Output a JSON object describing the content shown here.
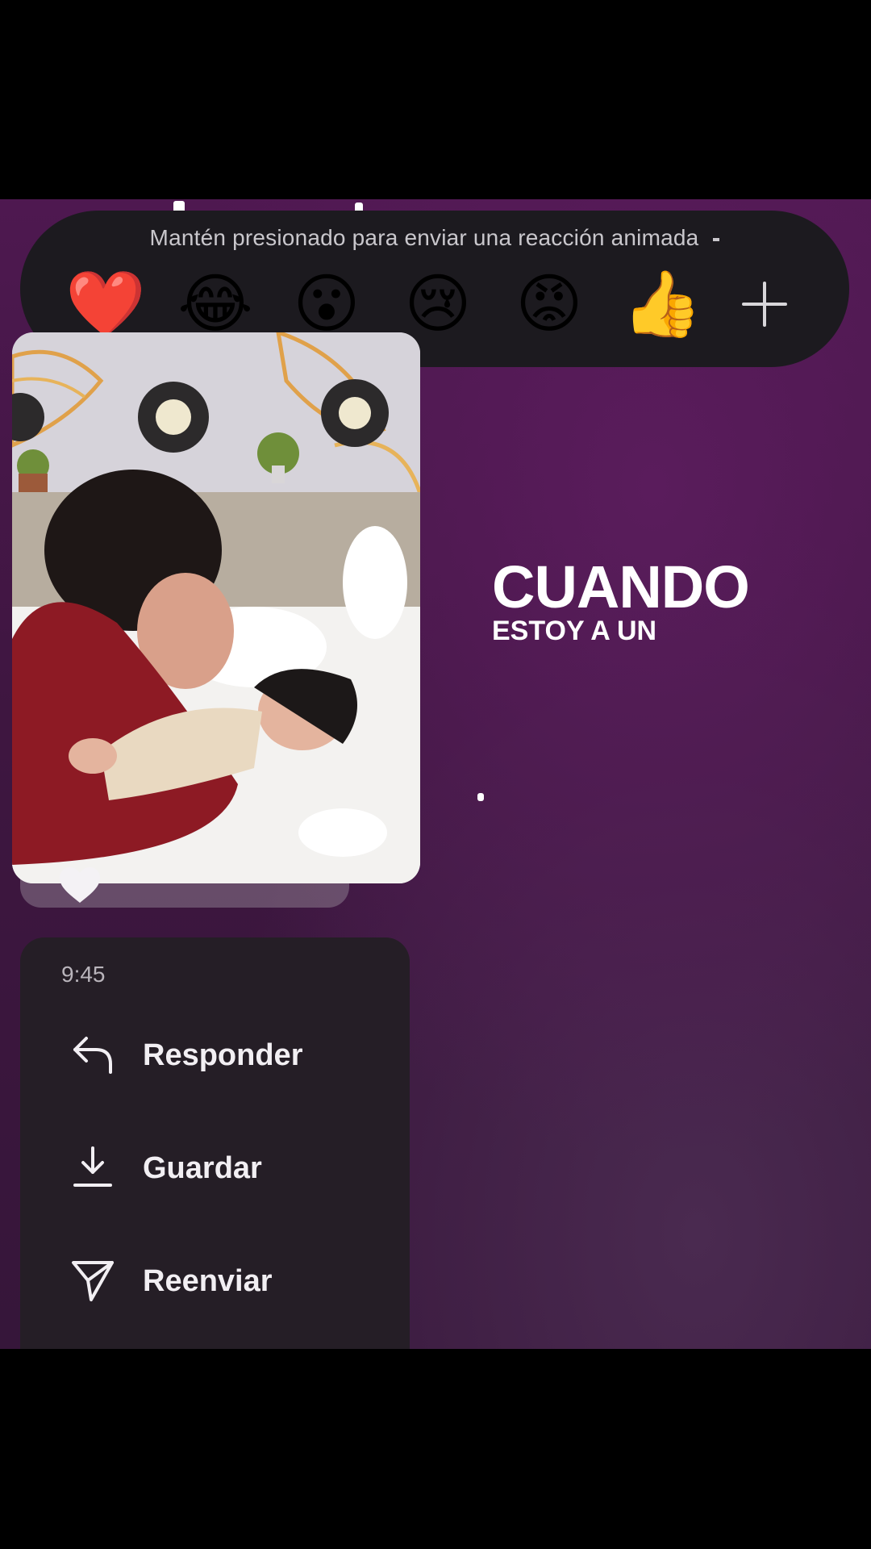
{
  "reaction_bar": {
    "hint": "Mantén presionado para enviar una reacción animada",
    "emojis": [
      {
        "icon": "red-heart",
        "glyph": "❤️"
      },
      {
        "icon": "tears-of-joy",
        "glyph": "😂"
      },
      {
        "icon": "surprised-face",
        "glyph": "😮"
      },
      {
        "icon": "crying-face",
        "glyph": "😢"
      },
      {
        "icon": "angry-face",
        "glyph": "😡"
      },
      {
        "icon": "thumbs-up",
        "glyph": "👍"
      }
    ],
    "more_icon": "plus-icon"
  },
  "video": {
    "overlay_title": "CUANDO",
    "overlay_subtitle": "ESTOY A UN",
    "reaction": "❤"
  },
  "context_menu": {
    "time": "9:45",
    "items": [
      {
        "icon": "reply-icon",
        "label": "Responder"
      },
      {
        "icon": "download-icon",
        "label": "Guardar"
      },
      {
        "icon": "send-icon",
        "label": "Reenviar"
      }
    ]
  },
  "colors": {
    "background": "#3e1640",
    "bar": "#1c1a1f",
    "menu": "#251e26",
    "text": "#f2eff3"
  }
}
